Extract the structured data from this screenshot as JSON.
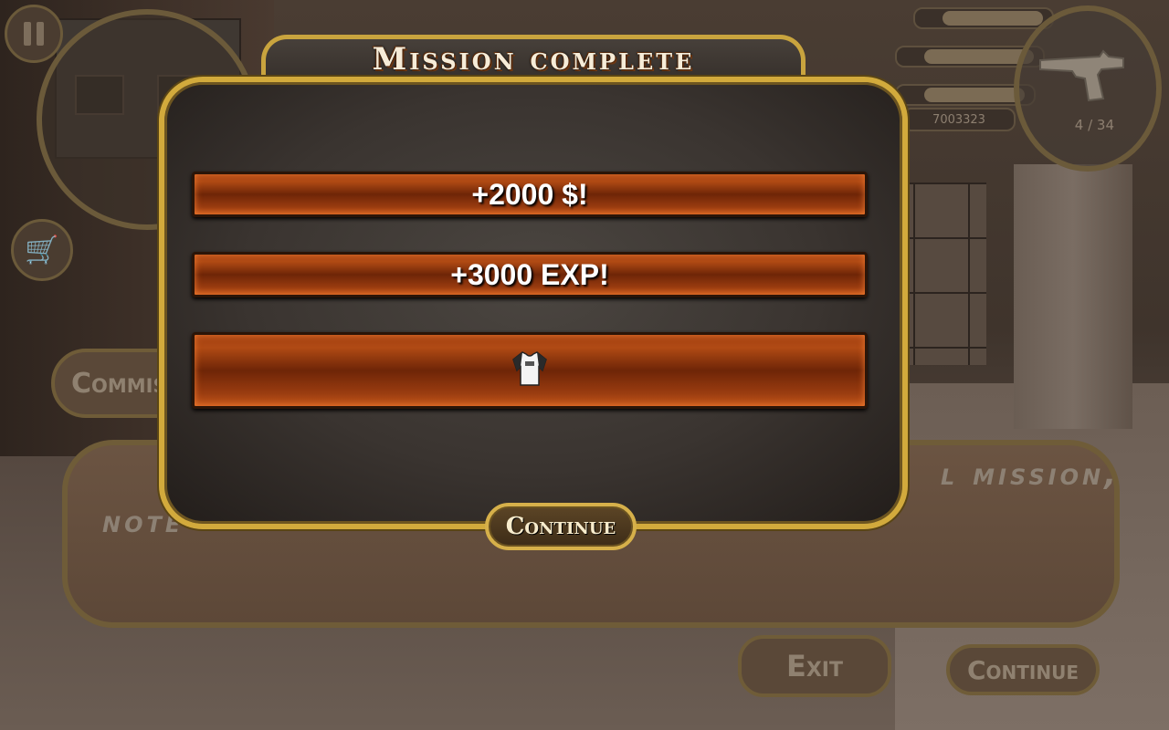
{
  "dialog": {
    "title": "Mission complete",
    "rewards": [
      {
        "label": "+2000 $!"
      },
      {
        "label": "+3000 EXP!"
      },
      {
        "label": "",
        "icon": "t-shirt-icon"
      }
    ],
    "continue_label": "Continue"
  },
  "hud": {
    "money": "7003323",
    "ammo": "4 / 34"
  },
  "background": {
    "comm_label": "Commis",
    "briefing_left": "note",
    "briefing_right": "l mission,",
    "exit_label": "Exit",
    "continue_label": "Continue"
  },
  "colors": {
    "gold_border": "#d2aa3c",
    "reward_orange": "#a34112",
    "title_text": "#f6ecd8"
  }
}
